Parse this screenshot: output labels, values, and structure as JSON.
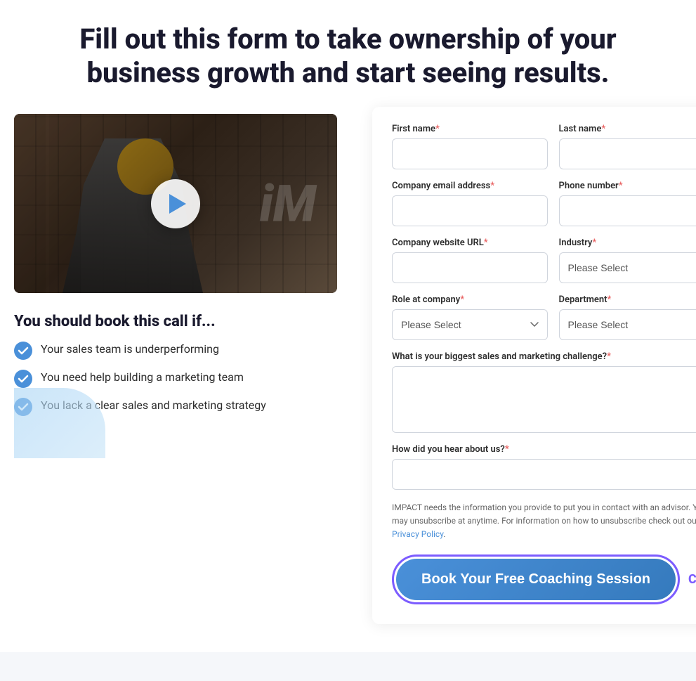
{
  "header": {
    "title_line1": "Fill out this form to take ownership of your",
    "title_line2": "business growth and start seeing results."
  },
  "video": {
    "play_label": "Play video"
  },
  "left": {
    "section_title": "You should book this call if...",
    "checklist": [
      "Your sales team is underperforming",
      "You need help building a marketing team",
      "You lack a clear sales and marketing strategy"
    ]
  },
  "form": {
    "first_name_label": "First name",
    "last_name_label": "Last name",
    "email_label": "Company email address",
    "phone_label": "Phone number",
    "website_label": "Company website URL",
    "industry_label": "Industry",
    "role_label": "Role at company",
    "department_label": "Department",
    "challenge_label": "What is your biggest sales and marketing challenge?",
    "hear_about_label": "How did you hear about us?",
    "please_select": "Please Select",
    "privacy_text": "IMPACT needs the information you provide to put you in contact with an advisor. You may unsubscribe at anytime. For information on how to unsubscribe check out our ",
    "privacy_link_text": "Privacy Policy",
    "cta_button_label": "Book Your Free Coaching Session",
    "cta_side_label": "CTA"
  }
}
